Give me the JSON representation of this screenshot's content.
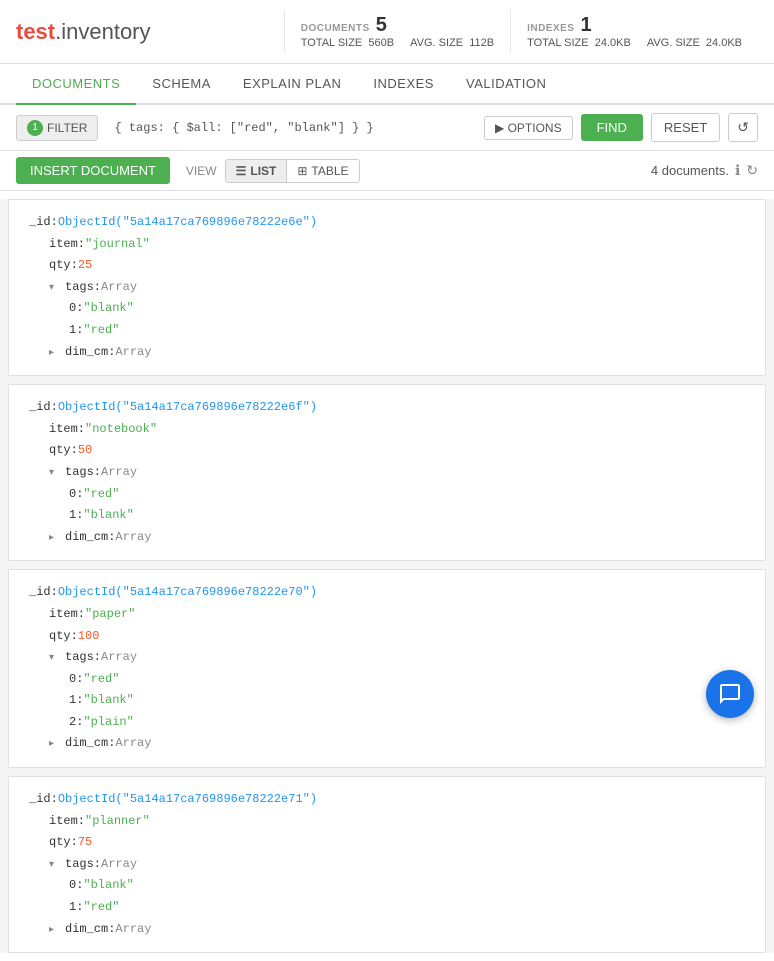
{
  "app": {
    "title_red": "test",
    "title_black": ".inventory"
  },
  "header": {
    "documents_label": "DOCUMENTS",
    "documents_count": "5",
    "total_size_label": "TOTAL SIZE",
    "documents_total_size": "560B",
    "avg_size_label": "AVG. SIZE",
    "documents_avg_size": "112B",
    "indexes_label": "INDEXES",
    "indexes_count": "1",
    "indexes_total_size": "24.0KB",
    "indexes_avg_size": "24.0KB"
  },
  "tabs": [
    {
      "id": "documents",
      "label": "DOCUMENTS",
      "active": true
    },
    {
      "id": "schema",
      "label": "SCHEMA",
      "active": false
    },
    {
      "id": "explain-plan",
      "label": "EXPLAIN PLAN",
      "active": false
    },
    {
      "id": "indexes",
      "label": "INDEXES",
      "active": false
    },
    {
      "id": "validation",
      "label": "VALIDATION",
      "active": false
    }
  ],
  "filter": {
    "badge": "1",
    "label": "FILTER",
    "query": "{ tags: { $all: [\"red\", \"blank\"] } }",
    "options_label": "▶ OPTIONS",
    "find_label": "FIND",
    "reset_label": "RESET"
  },
  "actionbar": {
    "insert_label": "INSERT DOCUMENT",
    "view_label": "VIEW",
    "list_label": "LIST",
    "table_label": "TABLE",
    "doc_count": "4 documents."
  },
  "documents": [
    {
      "id": "ObjectId(\"5a14a17ca769896e78222e6e\")",
      "item": "\"journal\"",
      "qty": "25",
      "tags": "Array",
      "tags_items": [
        {
          "index": "0",
          "value": "\"blank\""
        },
        {
          "index": "1",
          "value": "\"red\""
        }
      ],
      "dim_cm": "Array"
    },
    {
      "id": "ObjectId(\"5a14a17ca769896e78222e6f\")",
      "item": "\"notebook\"",
      "qty": "50",
      "tags": "Array",
      "tags_items": [
        {
          "index": "0",
          "value": "\"red\""
        },
        {
          "index": "1",
          "value": "\"blank\""
        }
      ],
      "dim_cm": "Array"
    },
    {
      "id": "ObjectId(\"5a14a17ca769896e78222e70\")",
      "item": "\"paper\"",
      "qty": "100",
      "tags": "Array",
      "tags_items": [
        {
          "index": "0",
          "value": "\"red\""
        },
        {
          "index": "1",
          "value": "\"blank\""
        },
        {
          "index": "2",
          "value": "\"plain\""
        }
      ],
      "dim_cm": "Array"
    },
    {
      "id": "ObjectId(\"5a14a17ca769896e78222e71\")",
      "item": "\"planner\"",
      "qty": "75",
      "tags": "Array",
      "tags_items": [
        {
          "index": "0",
          "value": "\"blank\""
        },
        {
          "index": "1",
          "value": "\"red\""
        }
      ],
      "dim_cm": "Array"
    }
  ]
}
